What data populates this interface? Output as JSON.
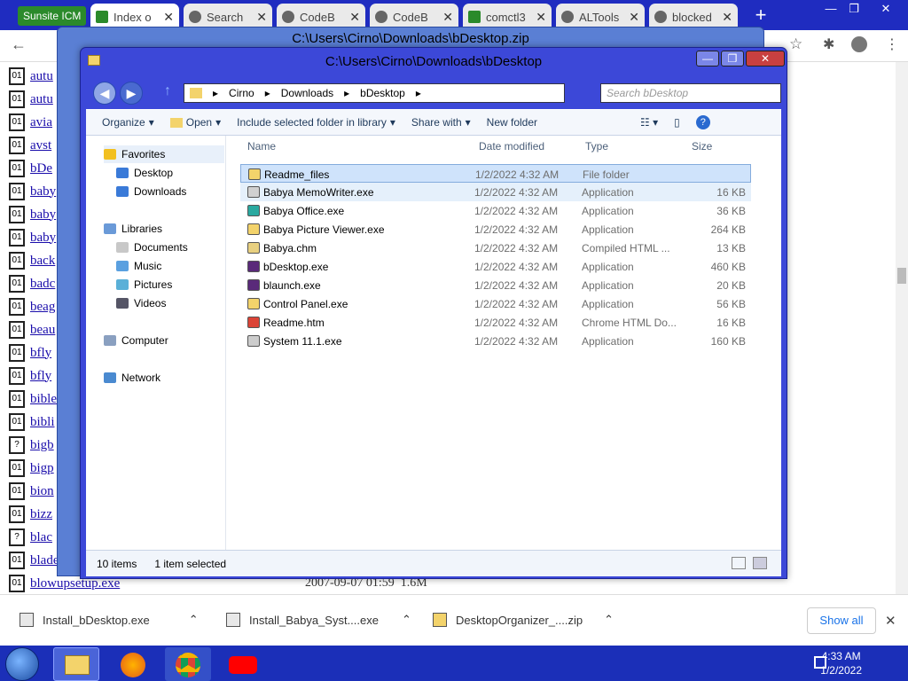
{
  "browser": {
    "tabs": [
      {
        "label": "Sunsite ICM",
        "active": false
      },
      {
        "label": "Index o",
        "active": true
      },
      {
        "label": "Search",
        "active": false
      },
      {
        "label": "CodeB",
        "active": false
      },
      {
        "label": "CodeB",
        "active": false
      },
      {
        "label": "comctl3",
        "active": false
      },
      {
        "label": "ALTools",
        "active": false
      },
      {
        "label": "blocked",
        "active": false
      }
    ],
    "new_tab": "+",
    "window_controls": {
      "minimize": "—",
      "maximize": "❐",
      "close": "✕"
    },
    "close_tab": "✕"
  },
  "page_listing": [
    {
      "name": "autu",
      "icon": "binary"
    },
    {
      "name": "autu",
      "icon": "exe"
    },
    {
      "name": "avia",
      "icon": "binary"
    },
    {
      "name": "avst",
      "icon": "binary"
    },
    {
      "name": "bDe",
      "icon": "exe"
    },
    {
      "name": "baby",
      "icon": "exe"
    },
    {
      "name": "baby",
      "icon": "exe"
    },
    {
      "name": "baby",
      "icon": "exe"
    },
    {
      "name": "back",
      "icon": "binary"
    },
    {
      "name": "badc",
      "icon": "binary"
    },
    {
      "name": "beag",
      "icon": "binary"
    },
    {
      "name": "beau",
      "icon": "exe"
    },
    {
      "name": "bfly",
      "icon": "binary"
    },
    {
      "name": "bfly",
      "icon": "binary"
    },
    {
      "name": "bible",
      "icon": "binary"
    },
    {
      "name": "bibli",
      "icon": "binary"
    },
    {
      "name": "bigb",
      "icon": "unknown"
    },
    {
      "name": "bigp",
      "icon": "binary"
    },
    {
      "name": "bion",
      "icon": "binary"
    },
    {
      "name": "bizz",
      "icon": "exe"
    },
    {
      "name": "blac",
      "icon": "unknown"
    },
    {
      "name": "blade.zi",
      "icon": "exe"
    },
    {
      "name": "blowupsetup.exe",
      "icon": "binary"
    }
  ],
  "page_footer_date": "2007-09-07 01:59",
  "page_footer_size": "1.6M",
  "back_window": {
    "title": "C:\\Users\\Cirno\\Downloads\\bDesktop.zip"
  },
  "explorer": {
    "title": "C:\\Users\\Cirno\\Downloads\\bDesktop",
    "window_controls": {
      "minimize": "—",
      "maximize": "❐",
      "close": "✕"
    },
    "breadcrumb": [
      "Cirno",
      "Downloads",
      "bDesktop"
    ],
    "search_placeholder": "Search bDesktop",
    "commands": {
      "organize": "Organize",
      "open": "Open",
      "include": "Include selected folder in library",
      "share": "Share with",
      "new_folder": "New folder"
    },
    "nav": {
      "favorites": "Favorites",
      "desktop": "Desktop",
      "downloads": "Downloads",
      "libraries": "Libraries",
      "documents": "Documents",
      "music": "Music",
      "pictures": "Pictures",
      "videos": "Videos",
      "computer": "Computer",
      "network": "Network"
    },
    "columns": {
      "name": "Name",
      "date": "Date modified",
      "type": "Type",
      "size": "Size"
    },
    "files": [
      {
        "name": "Readme_files",
        "date": "1/2/2022 4:32 AM",
        "type": "File folder",
        "size": "",
        "icon_color": "#f3d36b",
        "state": "sel"
      },
      {
        "name": "Babya MemoWriter.exe",
        "date": "1/2/2022 4:32 AM",
        "type": "Application",
        "size": "16 KB",
        "icon_color": "#d0d0d0",
        "state": "hov"
      },
      {
        "name": "Babya Office.exe",
        "date": "1/2/2022 4:32 AM",
        "type": "Application",
        "size": "36 KB",
        "icon_color": "#2aa9a0",
        "state": ""
      },
      {
        "name": "Babya Picture Viewer.exe",
        "date": "1/2/2022 4:32 AM",
        "type": "Application",
        "size": "264 KB",
        "icon_color": "#f3d36b",
        "state": ""
      },
      {
        "name": "Babya.chm",
        "date": "1/2/2022 4:32 AM",
        "type": "Compiled HTML ...",
        "size": "13 KB",
        "icon_color": "#e8d080",
        "state": ""
      },
      {
        "name": "bDesktop.exe",
        "date": "1/2/2022 4:32 AM",
        "type": "Application",
        "size": "460 KB",
        "icon_color": "#5a2a7a",
        "state": ""
      },
      {
        "name": "blaunch.exe",
        "date": "1/2/2022 4:32 AM",
        "type": "Application",
        "size": "20 KB",
        "icon_color": "#5a2a7a",
        "state": ""
      },
      {
        "name": "Control Panel.exe",
        "date": "1/2/2022 4:32 AM",
        "type": "Application",
        "size": "56 KB",
        "icon_color": "#f3d36b",
        "state": ""
      },
      {
        "name": "Readme.htm",
        "date": "1/2/2022 4:32 AM",
        "type": "Chrome HTML Do...",
        "size": "16 KB",
        "icon_color": "#db4437",
        "state": ""
      },
      {
        "name": "System 11.1.exe",
        "date": "1/2/2022 4:32 AM",
        "type": "Application",
        "size": "160 KB",
        "icon_color": "#cccccc",
        "state": ""
      }
    ],
    "status": {
      "items": "10 items",
      "selected": "1 item selected"
    }
  },
  "downloads": [
    {
      "name": "Install_bDesktop.exe"
    },
    {
      "name": "Install_Babya_Syst....exe"
    },
    {
      "name": "DesktopOrganizer_....zip"
    }
  ],
  "show_all": "Show all",
  "clock": {
    "time": "4:33 AM",
    "date": "1/2/2022"
  }
}
